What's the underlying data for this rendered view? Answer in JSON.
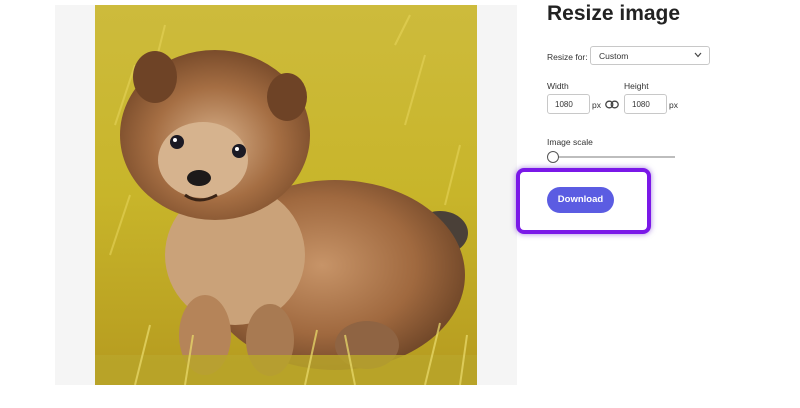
{
  "title": "Resize image",
  "resize_for": {
    "label": "Resize for:",
    "value": "Custom"
  },
  "width": {
    "label": "Width",
    "value": "1080",
    "unit": "px"
  },
  "height": {
    "label": "Height",
    "value": "1080",
    "unit": "px"
  },
  "image_scale": {
    "label": "Image scale",
    "level": 0
  },
  "download_label": "Download",
  "colors": {
    "accent": "#5b5ce2",
    "highlight": "#7a18e8",
    "preview_bg": "#f5f5f5"
  },
  "icons": {
    "link": "link-icon",
    "chevron": "chevron-down-icon"
  }
}
